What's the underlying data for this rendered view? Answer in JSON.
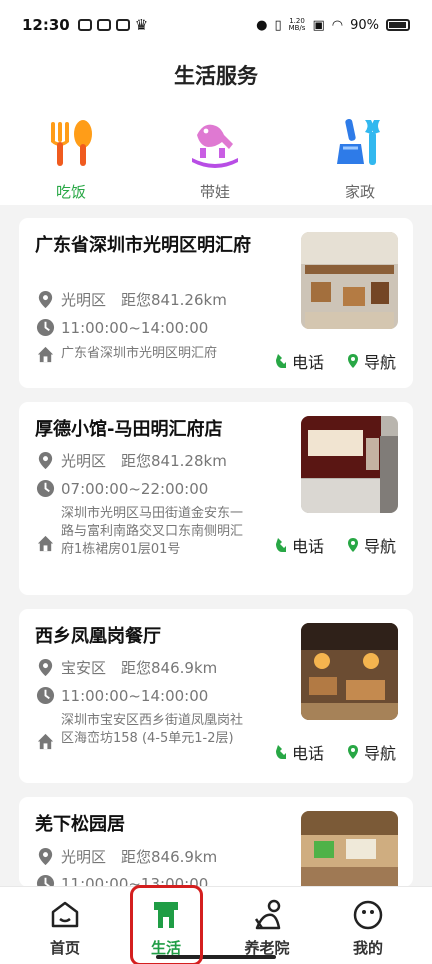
{
  "status": {
    "time": "12:30",
    "network_speed": "1.20",
    "network_unit": "MB/s",
    "battery": "90%"
  },
  "page_title": "生活服务",
  "categories": [
    {
      "label": "吃饭"
    },
    {
      "label": "带娃"
    },
    {
      "label": "家政"
    }
  ],
  "restaurants": [
    {
      "name": "广东省深圳市光明区明汇府",
      "district": "光明区",
      "distance": "距您841.26km",
      "hours": "11:00:00~14:00:00",
      "address": "广东省深圳市光明区明汇府",
      "phone_label": "电话",
      "nav_label": "导航"
    },
    {
      "name": "厚德小馆-马田明汇府店",
      "district": "光明区",
      "distance": "距您841.28km",
      "hours": "07:00:00~22:00:00",
      "address": "深圳市光明区马田街道金安东一路与富利南路交叉口东南侧明汇府1栋裙房01层01号",
      "phone_label": "电话",
      "nav_label": "导航"
    },
    {
      "name": "西乡凤凰岗餐厅",
      "district": "宝安区",
      "distance": "距您846.9km",
      "hours": "11:00:00~14:00:00",
      "address": "深圳市宝安区西乡街道凤凰岗社区海峦坊158 (4-5单元1-2层)",
      "phone_label": "电话",
      "nav_label": "导航"
    },
    {
      "name": "羌下松园居",
      "district": "光明区",
      "distance": "距您846.9km",
      "hours": "11:00:00~13:00:00"
    }
  ],
  "tabs": [
    {
      "label": "首页"
    },
    {
      "label": "生活"
    },
    {
      "label": "养老院"
    },
    {
      "label": "我的"
    }
  ],
  "colors": {
    "accent": "#28a745",
    "highlight": "#d41f1f"
  }
}
